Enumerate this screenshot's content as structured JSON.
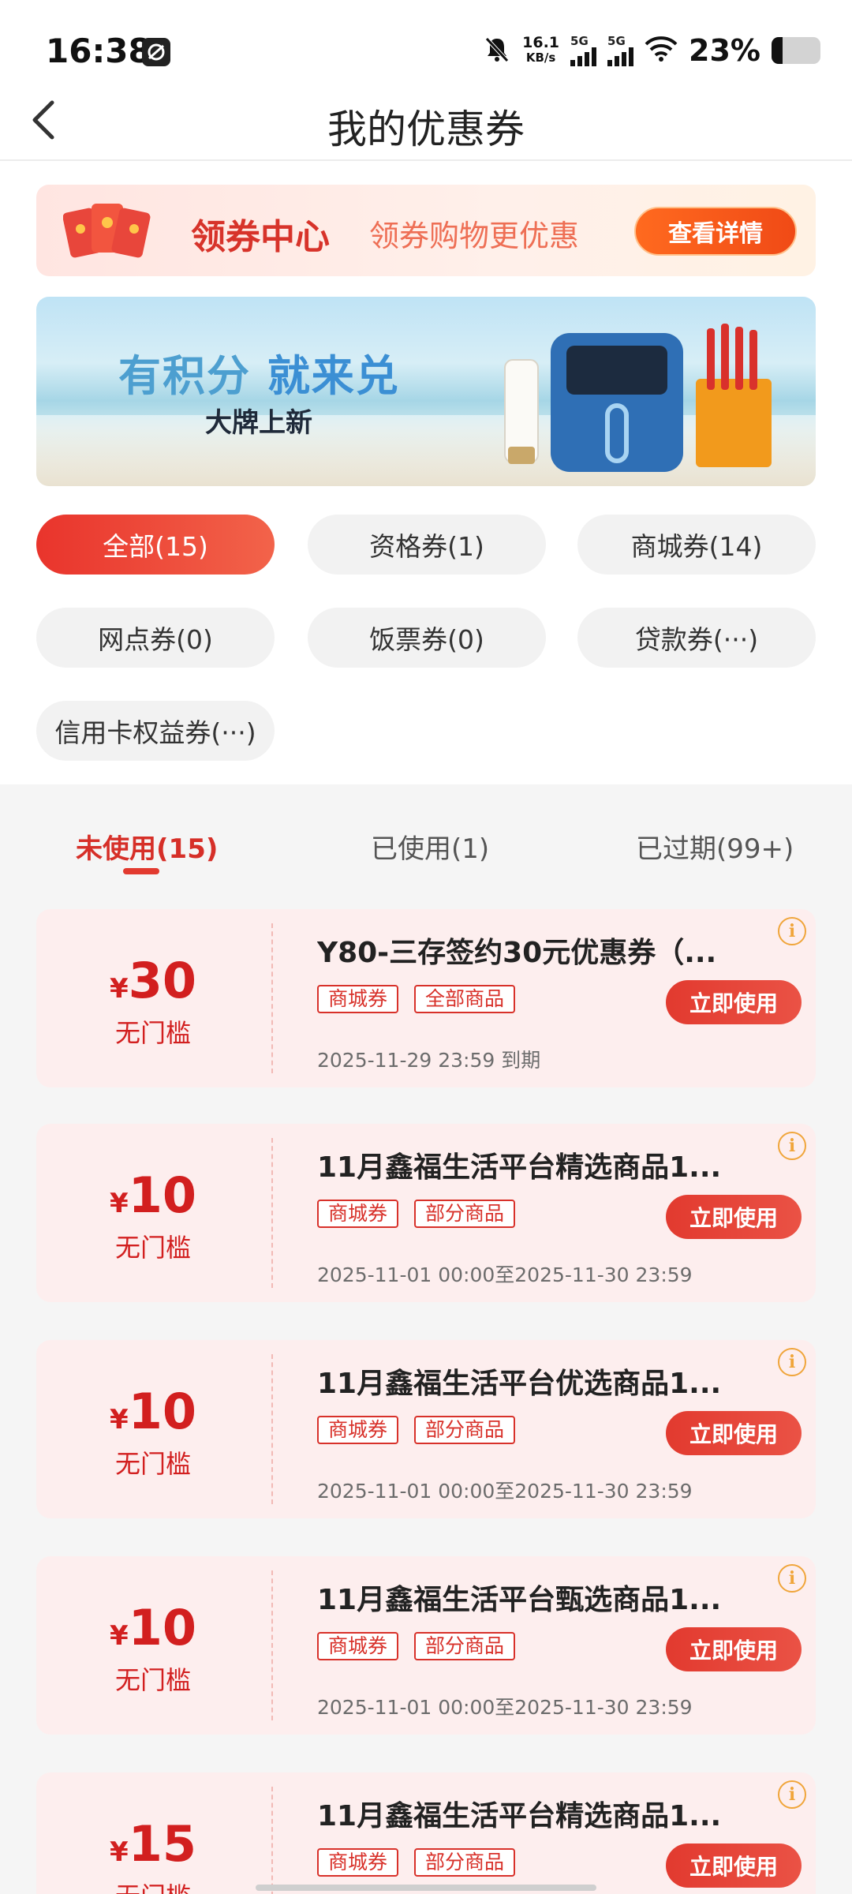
{
  "status_bar": {
    "time": "16:38",
    "net_speed_value": "16.1",
    "net_speed_unit": "KB/s",
    "signal_1": "5G",
    "signal_2": "5G",
    "battery": "23%",
    "battery_level": 0.23,
    "icons": [
      "app-icon",
      "mute-icon",
      "signal-icon",
      "signal-icon",
      "wifi-icon",
      "battery-icon"
    ]
  },
  "header": {
    "title": "我的优惠券",
    "back_icon": "chevron-left-icon"
  },
  "coupon_center": {
    "title": "领券中心",
    "subtitle": "领券购物更优惠",
    "button": "查看详情",
    "icon": "red-envelope-icon"
  },
  "promo_banner": {
    "title_part1": "有积分",
    "title_part2": "就来兑",
    "subtitle": "大牌上新"
  },
  "filters": [
    {
      "label": "全部(15)",
      "active": true
    },
    {
      "label": "资格券(1)",
      "active": false
    },
    {
      "label": "商城券(14)",
      "active": false
    },
    {
      "label": "网点券(0)",
      "active": false
    },
    {
      "label": "饭票券(0)",
      "active": false
    },
    {
      "label": "贷款券(···)",
      "active": false
    },
    {
      "label": "信用卡权益券(···)",
      "active": false
    }
  ],
  "tabs": [
    {
      "label": "未使用(15)",
      "active": true
    },
    {
      "label": "已使用(1)",
      "active": false
    },
    {
      "label": "已过期(99+)",
      "active": false
    }
  ],
  "coupons": [
    {
      "currency": "¥",
      "amount": "30",
      "threshold": "无门槛",
      "title": "Y80-三存签约30元优惠券（...",
      "tags": [
        "商城券",
        "全部商品"
      ],
      "button": "立即使用",
      "date": "2025-11-29 23:59 到期"
    },
    {
      "currency": "¥",
      "amount": "10",
      "threshold": "无门槛",
      "title": "11月鑫福生活平台精选商品1...",
      "tags": [
        "商城券",
        "部分商品"
      ],
      "button": "立即使用",
      "date": "2025-11-01 00:00至2025-11-30 23:59"
    },
    {
      "currency": "¥",
      "amount": "10",
      "threshold": "无门槛",
      "title": "11月鑫福生活平台优选商品1...",
      "tags": [
        "商城券",
        "部分商品"
      ],
      "button": "立即使用",
      "date": "2025-11-01 00:00至2025-11-30 23:59"
    },
    {
      "currency": "¥",
      "amount": "10",
      "threshold": "无门槛",
      "title": "11月鑫福生活平台甄选商品1...",
      "tags": [
        "商城券",
        "部分商品"
      ],
      "button": "立即使用",
      "date": "2025-11-01 00:00至2025-11-30 23:59"
    },
    {
      "currency": "¥",
      "amount": "15",
      "threshold": "无门槛",
      "title": "11月鑫福生活平台精选商品1...",
      "tags": [
        "商城券",
        "部分商品"
      ],
      "button": "立即使用",
      "date": ""
    }
  ],
  "colors": {
    "accent": "#e23a2f",
    "coupon_bg": "#fdeeee",
    "amount": "#d21f1f",
    "info": "#f0a53a"
  }
}
